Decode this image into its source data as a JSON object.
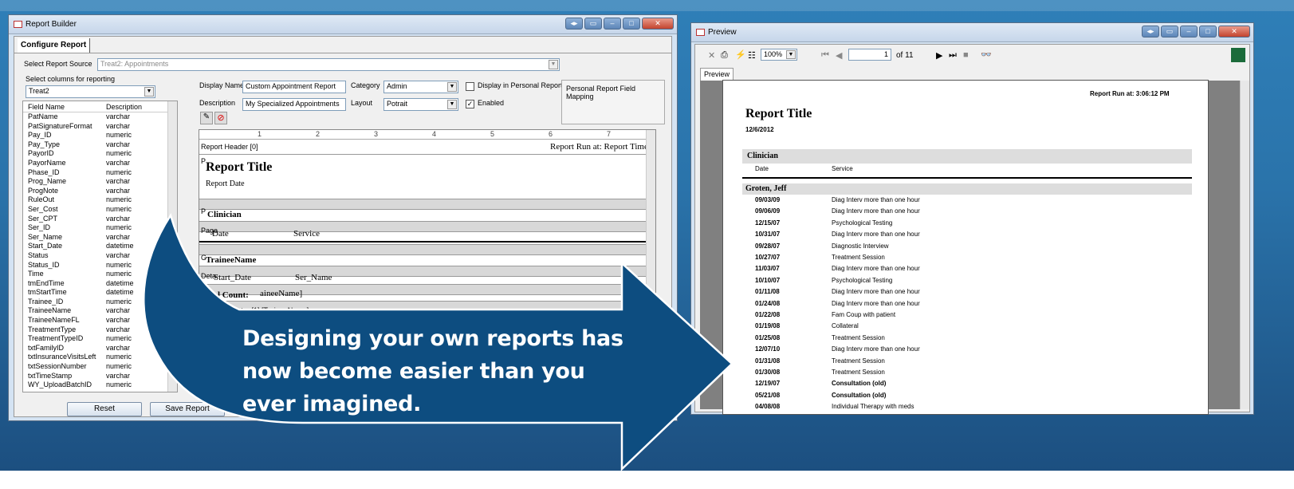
{
  "report_builder": {
    "title": "Report Builder",
    "tab": "Configure Report",
    "source_label": "Select Report Source",
    "source_value": "Treat2: Appointments",
    "group_label": "Select columns for reporting",
    "table_value": "Treat2",
    "col_field": "Field Name",
    "col_desc": "Description",
    "fields": [
      [
        "PatName",
        "varchar"
      ],
      [
        "PatSignatureFormat",
        "varchar"
      ],
      [
        "Pay_ID",
        "numeric"
      ],
      [
        "Pay_Type",
        "varchar"
      ],
      [
        "PayorID",
        "numeric"
      ],
      [
        "PayorName",
        "varchar"
      ],
      [
        "Phase_ID",
        "numeric"
      ],
      [
        "Prog_Name",
        "varchar"
      ],
      [
        "ProgNote",
        "varchar"
      ],
      [
        "RuleOut",
        "numeric"
      ],
      [
        "Ser_Cost",
        "numeric"
      ],
      [
        "Ser_CPT",
        "varchar"
      ],
      [
        "Ser_ID",
        "numeric"
      ],
      [
        "Ser_Name",
        "varchar"
      ],
      [
        "Start_Date",
        "datetime"
      ],
      [
        "Status",
        "varchar"
      ],
      [
        "Status_ID",
        "numeric"
      ],
      [
        "Time",
        "numeric"
      ],
      [
        "tmEndTime",
        "datetime"
      ],
      [
        "tmStartTime",
        "datetime"
      ],
      [
        "Trainee_ID",
        "numeric"
      ],
      [
        "TraineeName",
        "varchar"
      ],
      [
        "TraineeNameFL",
        "varchar"
      ],
      [
        "TreatmentType",
        "varchar"
      ],
      [
        "TreatmentTypeID",
        "numeric"
      ],
      [
        "txtFamilyID",
        "varchar"
      ],
      [
        "txtInsuranceVisitsLeft",
        "numeric"
      ],
      [
        "txtSessionNumber",
        "numeric"
      ],
      [
        "txtTimeStamp",
        "varchar"
      ],
      [
        "WY_UploadBatchID",
        "numeric"
      ]
    ],
    "display_name_label": "Display Name",
    "display_name_value": "Custom Appointment Report",
    "category_label": "Category",
    "category_value": "Admin",
    "description_label": "Description",
    "description_value": "My Specialized Appointments",
    "layout_label": "Layout",
    "layout_value": "Potrait",
    "display_personal_label": "Display in Personal Reports",
    "enabled_label": "Enabled",
    "personal_mapping_label": "Personal Report Field Mapping",
    "ruler_marks": [
      "1",
      "2",
      "3",
      "4",
      "5",
      "6",
      "7"
    ],
    "designer": {
      "report_header_band": "Report Header [0]",
      "report_run_at": "Report Run at:",
      "report_time": "Report Time",
      "report_title": "Report Title",
      "report_date": "Report Date",
      "band_p": "P",
      "clinician": "Clinician",
      "page_label": "Page",
      "date_col": "Date",
      "service_col": "Service",
      "band_g": "G",
      "trainee_name": "TraineeName",
      "detail_label": "Deta",
      "start_date": "Start_Date",
      "ser_name": "Ser_Name",
      "total_count": "Total Count:",
      "trainee_name_ref": "aineeName]",
      "group_footer": "Group 1 Footer [1] [TraineeName]"
    },
    "reset_button": "Reset",
    "save_button": "Save Report"
  },
  "preview": {
    "title": "Preview",
    "zoom": "100%",
    "page_input": "1",
    "page_total": "of 11",
    "tab": "Preview",
    "report_run_at": "Report Run at: 3:06:12 PM",
    "report_title": "Report Title",
    "report_date": "12/6/2012",
    "group_header": "Clinician",
    "col_date": "Date",
    "col_service": "Service",
    "group_name": "Groten, Jeff",
    "rows": [
      [
        "09/03/09",
        "Diag Interv more than one hour",
        false
      ],
      [
        "09/06/09",
        "Diag Interv more than one hour",
        false
      ],
      [
        "12/15/07",
        "Psychological Testing",
        false
      ],
      [
        "10/31/07",
        "Diag Interv more than one hour",
        false
      ],
      [
        "09/28/07",
        "Diagnostic Interview",
        false
      ],
      [
        "10/27/07",
        "Treatment Session",
        false
      ],
      [
        "11/03/07",
        "Diag Interv more than one hour",
        false
      ],
      [
        "10/10/07",
        "Psychological Testing",
        false
      ],
      [
        "01/11/08",
        "Diag Interv more than one hour",
        false
      ],
      [
        "01/24/08",
        "Diag Interv more than one hour",
        false
      ],
      [
        "01/22/08",
        "Fam Coup with patient",
        false
      ],
      [
        "01/19/08",
        "Collateral",
        false
      ],
      [
        "01/25/08",
        "Treatment Session",
        false
      ],
      [
        "12/07/10",
        "Diag Interv more than one hour",
        false
      ],
      [
        "01/31/08",
        "Treatment Session",
        false
      ],
      [
        "01/30/08",
        "Treatment Session",
        false
      ],
      [
        "12/19/07",
        "Consultation (old)",
        true
      ],
      [
        "05/21/08",
        "Consultation (old)",
        true
      ],
      [
        "04/08/08",
        "Individual Therapy with meds",
        false
      ]
    ]
  },
  "banner": {
    "line1": "Designing your own reports has",
    "line2": "now become easier than you",
    "line3": "ever imagined."
  }
}
